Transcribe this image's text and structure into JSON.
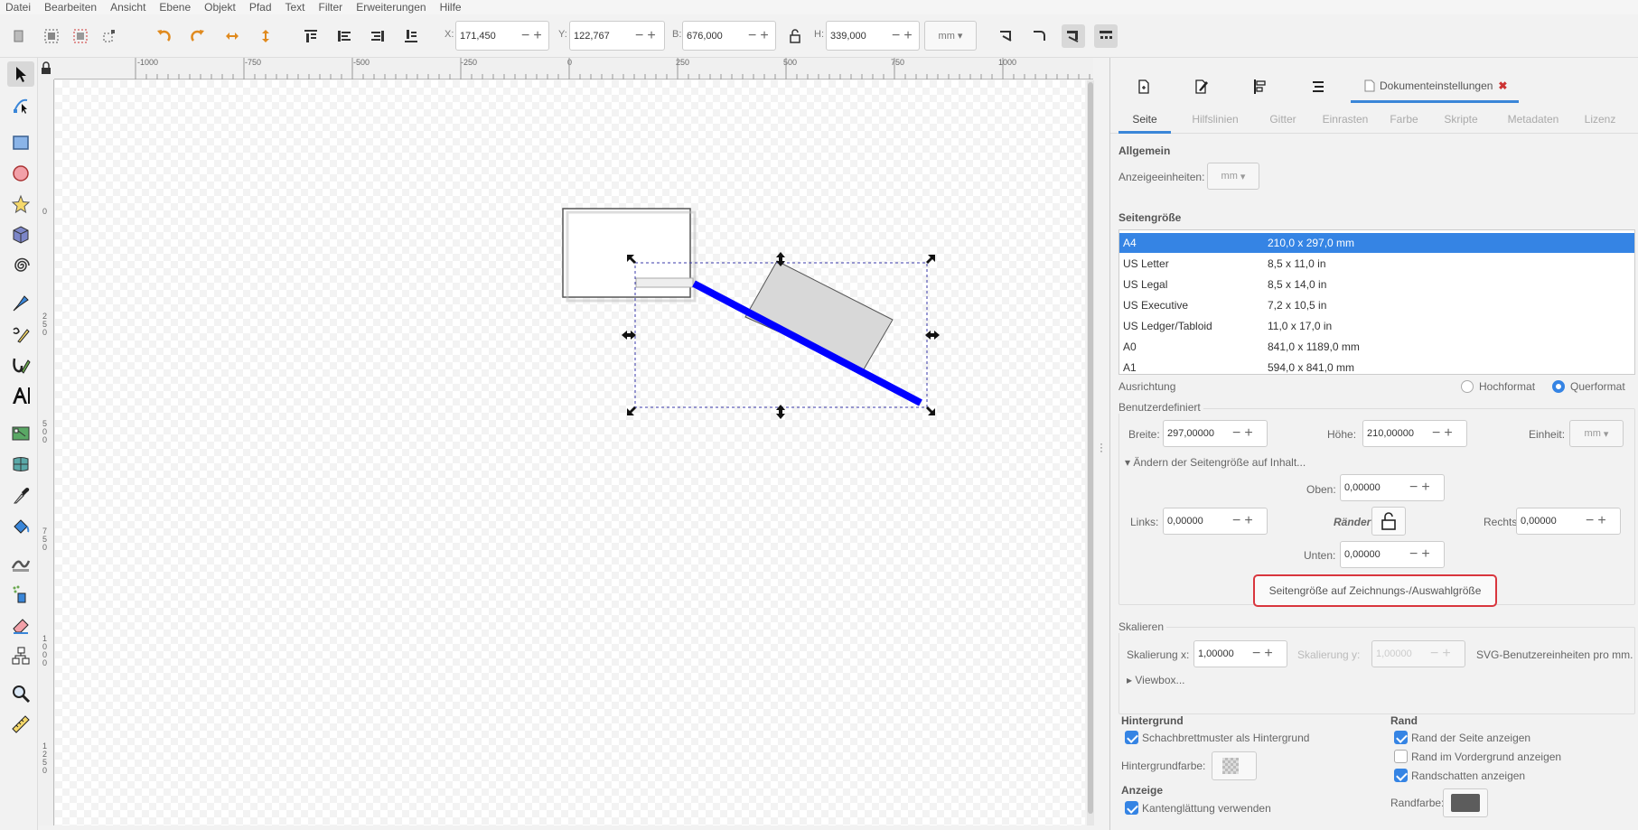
{
  "menu": [
    "Datei",
    "Bearbeiten",
    "Ansicht",
    "Ebene",
    "Objekt",
    "Pfad",
    "Text",
    "Filter",
    "Erweiterungen",
    "Hilfe"
  ],
  "toolbar": {
    "x_label": "X:",
    "x_value": "171,450",
    "y_label": "Y:",
    "y_value": "122,767",
    "w_label": "B:",
    "w_value": "676,000",
    "h_label": "H:",
    "h_value": "339,000",
    "unit": "mm"
  },
  "ruler_top": [
    "-1000",
    "-750",
    "-500",
    "-250",
    "0",
    "250",
    "500",
    "750",
    "1000"
  ],
  "ruler_left": [
    "0",
    "2 5 0",
    "5 0 0",
    "7 5 0",
    "1 0 0 0",
    "1 2 5 0"
  ],
  "panel": {
    "doc_tab_title": "Dokumenteinstellungen",
    "close_glyph": "✖",
    "subtabs": [
      "Seite",
      "Hilfslinien",
      "Gitter",
      "Einrasten",
      "Farbe",
      "Skripte",
      "Metadaten",
      "Lizenz"
    ],
    "general_heading": "Allgemein",
    "display_units_label": "Anzeigeeinheiten:",
    "display_units_value": "mm",
    "page_size_heading": "Seitengröße",
    "page_sizes": [
      {
        "name": "A4",
        "size": "210,0 x 297,0 mm"
      },
      {
        "name": "US Letter",
        "size": "8,5 x 11,0 in"
      },
      {
        "name": "US Legal",
        "size": "8,5 x 14,0 in"
      },
      {
        "name": "US Executive",
        "size": "7,2 x 10,5 in"
      },
      {
        "name": "US Ledger/Tabloid",
        "size": "11,0 x 17,0 in"
      },
      {
        "name": "A0",
        "size": "841,0 x 1189,0 mm"
      },
      {
        "name": "A1",
        "size": "594,0 x 841,0 mm"
      }
    ],
    "orientation_label": "Ausrichtung",
    "portrait_label": "Hochformat",
    "landscape_label": "Querformat",
    "custom_label": "Benutzerdefiniert",
    "width_label": "Breite:",
    "width_value": "297,00000",
    "height_label": "Höhe:",
    "height_value": "210,00000",
    "unit_label": "Einheit:",
    "unit_value": "mm",
    "resize_expander": "Ändern der Seitengröße auf Inhalt...",
    "top_label": "Oben:",
    "top_value": "0,00000",
    "left_label": "Links:",
    "left_value": "0,00000",
    "margins_label": "Ränder",
    "right_label": "Rechts:",
    "right_value": "0,00000",
    "bottom_label": "Unten:",
    "bottom_value": "0,00000",
    "fit_button": "Seitengröße auf Zeichnungs-/Auswahlgröße",
    "scale_label": "Skalieren",
    "scale_x_label": "Skalierung x:",
    "scale_x_value": "1,00000",
    "scale_y_label": "Skalierung y:",
    "scale_y_value": "1,00000",
    "svg_units_label": "SVG-Benutzereinheiten pro mm.",
    "viewbox_label": "Viewbox...",
    "background_heading": "Hintergrund",
    "checker_label": "Schachbrettmuster als Hintergrund",
    "bgcolor_label": "Hintergrundfarbe:",
    "display_heading": "Anzeige",
    "antialias_label": "Kantenglättung verwenden",
    "border_heading": "Rand",
    "show_border_label": "Rand der Seite anzeigen",
    "border_front_label": "Rand im Vordergrund anzeigen",
    "shadow_label": "Randschatten anzeigen",
    "border_color_label": "Randfarbe:"
  },
  "colors": {
    "accent": "#3584e4",
    "highlight": "#d9363e",
    "line": "#0000ff",
    "border_swatch": "#5c5c5c"
  }
}
